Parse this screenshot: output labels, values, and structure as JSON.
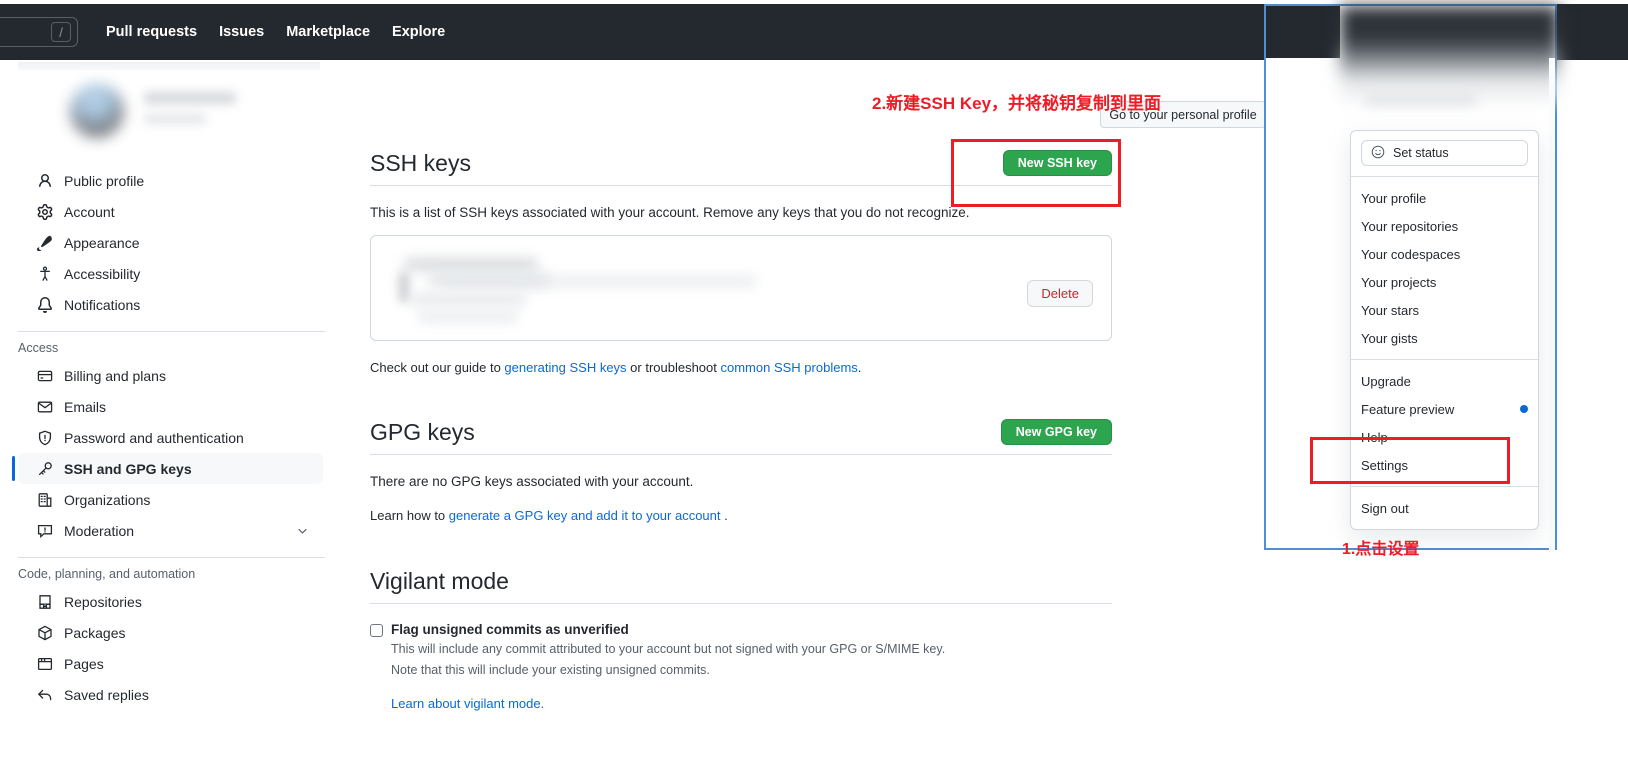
{
  "header": {
    "search_placeholder": "",
    "slash_hint": "/",
    "nav": [
      {
        "label": "Pull requests"
      },
      {
        "label": "Issues"
      },
      {
        "label": "Marketplace"
      },
      {
        "label": "Explore"
      }
    ]
  },
  "sidebar": {
    "group1": [
      {
        "label": "Public profile",
        "icon": "person-icon"
      },
      {
        "label": "Account",
        "icon": "gear-icon"
      },
      {
        "label": "Appearance",
        "icon": "paintbrush-icon"
      },
      {
        "label": "Accessibility",
        "icon": "accessibility-icon"
      },
      {
        "label": "Notifications",
        "icon": "bell-icon"
      }
    ],
    "group2_title": "Access",
    "group2": [
      {
        "label": "Billing and plans",
        "icon": "credit-card-icon"
      },
      {
        "label": "Emails",
        "icon": "mail-icon"
      },
      {
        "label": "Password and authentication",
        "icon": "shield-icon"
      },
      {
        "label": "SSH and GPG keys",
        "icon": "key-icon",
        "selected": true
      },
      {
        "label": "Organizations",
        "icon": "organization-icon"
      },
      {
        "label": "Moderation",
        "icon": "report-icon",
        "chevron": true
      }
    ],
    "group3_title": "Code, planning, and automation",
    "group3": [
      {
        "label": "Repositories",
        "icon": "repo-icon"
      },
      {
        "label": "Packages",
        "icon": "package-icon"
      },
      {
        "label": "Pages",
        "icon": "browser-icon"
      },
      {
        "label": "Saved replies",
        "icon": "reply-icon"
      }
    ]
  },
  "main": {
    "ssh": {
      "title": "SSH keys",
      "new_button": "New SSH key",
      "description": "This is a list of SSH keys associated with your account. Remove any keys that you do not recognize.",
      "delete_button": "Delete",
      "guide_prefix": "Check out our guide to ",
      "guide_link1": "generating SSH keys",
      "guide_middle": " or troubleshoot ",
      "guide_link2": "common SSH problems",
      "guide_suffix": "."
    },
    "gpg": {
      "title": "GPG keys",
      "new_button": "New GPG key",
      "empty_text": "There are no GPG keys associated with your account.",
      "learn_prefix": "Learn how to ",
      "learn_link": "generate a GPG key and add it to your account",
      "learn_suffix": " ."
    },
    "vigilant": {
      "title": "Vigilant mode",
      "checkbox_label": "Flag unsigned commits as unverified",
      "sub_line1": "This will include any commit attributed to your account but not signed with your GPG or S/MIME key.",
      "sub_line2": "Note that this will include your existing unsigned commits.",
      "learn_link": "Learn about vigilant mode."
    }
  },
  "tooltip": {
    "text": "Go to your personal profile"
  },
  "dropdown": {
    "set_status": "Set status",
    "group1": [
      {
        "label": "Your profile"
      },
      {
        "label": "Your repositories"
      },
      {
        "label": "Your codespaces"
      },
      {
        "label": "Your projects"
      },
      {
        "label": "Your stars"
      },
      {
        "label": "Your gists"
      }
    ],
    "group2": [
      {
        "label": "Upgrade"
      },
      {
        "label": "Feature preview",
        "dot": true
      },
      {
        "label": "Help"
      },
      {
        "label": "Settings"
      }
    ],
    "group3": [
      {
        "label": "Sign out"
      }
    ]
  },
  "annotations": {
    "step2": "2.新建SSH Key，并将秘钥复制到里面",
    "step1": "1.点击设置"
  },
  "colors": {
    "header_bg": "#24292f",
    "green_button": "#2da44e",
    "link_blue": "#0969da",
    "annotation_red": "#ee1c25",
    "delete_red": "#cf222e",
    "accent_blue": "#4b8fd4"
  }
}
